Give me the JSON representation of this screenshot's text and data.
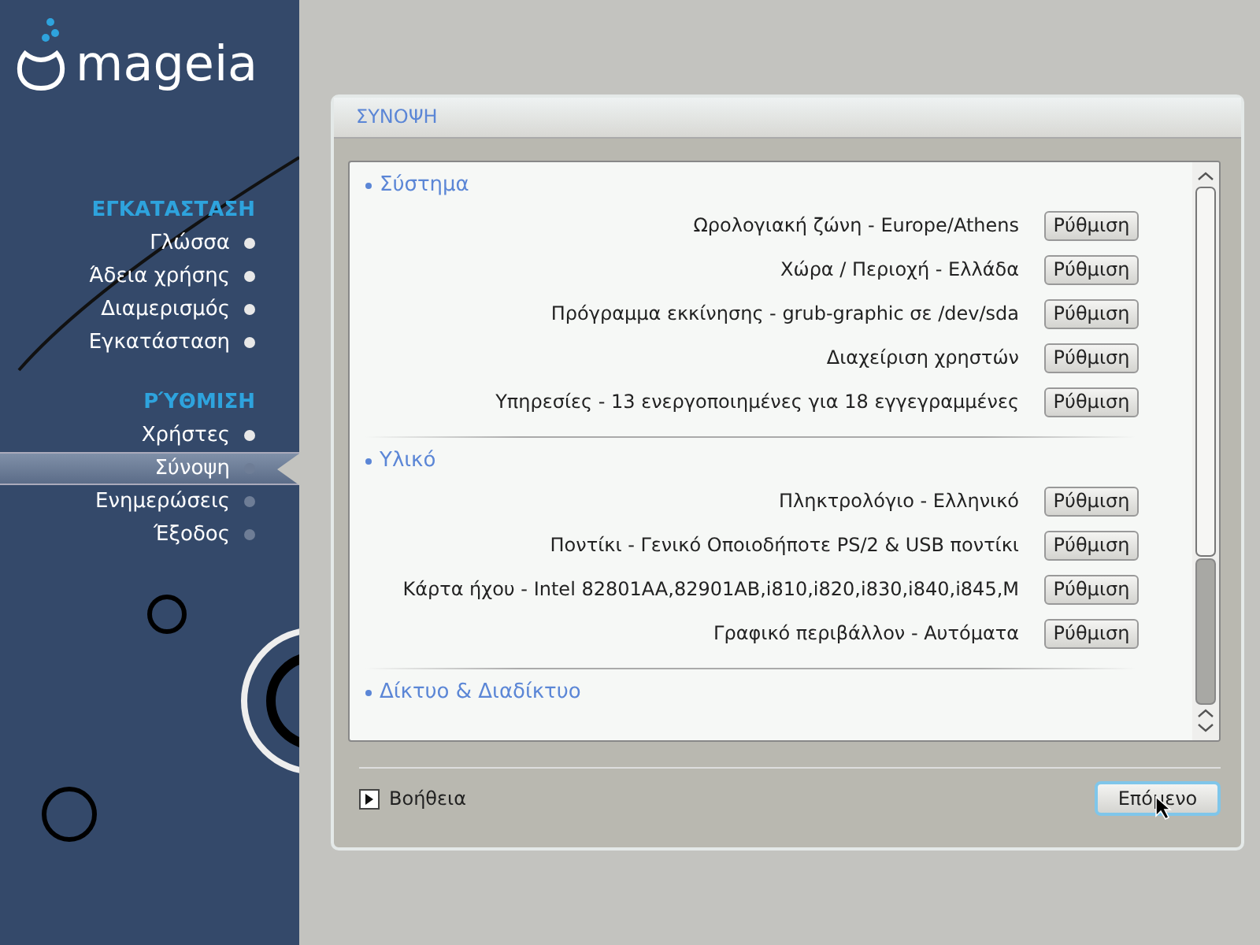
{
  "logo_text": "mageia",
  "sidebar": {
    "groups": [
      {
        "title": "ΕΓΚΑΤΑΣΤΑΣΗ",
        "items": [
          {
            "label": "Γλώσσα",
            "done": true,
            "selected": false
          },
          {
            "label": "Άδεια χρήσης",
            "done": true,
            "selected": false
          },
          {
            "label": "Διαμερισμός",
            "done": true,
            "selected": false
          },
          {
            "label": "Εγκατάσταση",
            "done": true,
            "selected": false
          }
        ]
      },
      {
        "title": "ΡΎΘΜΙΣΗ",
        "items": [
          {
            "label": "Χρήστες",
            "done": true,
            "selected": false
          },
          {
            "label": "Σύνοψη",
            "done": false,
            "selected": true
          },
          {
            "label": "Ενημερώσεις",
            "done": false,
            "selected": false
          },
          {
            "label": "Έξοδος",
            "done": false,
            "selected": false
          }
        ]
      }
    ]
  },
  "panel": {
    "title": "ΣΥΝΟΨΗ",
    "sections": [
      {
        "title": "Σύστημα",
        "rows": [
          {
            "text": "Ωρολογιακή ζώνη - Europe/Athens",
            "button": "Ρύθμιση"
          },
          {
            "text": "Χώρα / Περιοχή - Ελλάδα",
            "button": "Ρύθμιση"
          },
          {
            "text": "Πρόγραμμα εκκίνησης - grub-graphic σε /dev/sda",
            "button": "Ρύθμιση"
          },
          {
            "text": "Διαχείριση χρηστών",
            "button": "Ρύθμιση"
          },
          {
            "text": "Υπηρεσίες - 13 ενεργοποιημένες για 18 εγγεγραμμένες",
            "button": "Ρύθμιση"
          }
        ]
      },
      {
        "title": "Υλικό",
        "rows": [
          {
            "text": "Πληκτρολόγιο - Ελληνικό",
            "button": "Ρύθμιση"
          },
          {
            "text": "Ποντίκι - Γενικό Οποιοδήποτε PS/2 & USB ποντίκι",
            "button": "Ρύθμιση"
          },
          {
            "text": "Κάρτα ήχου - Intel 82801AA,82901AB,i810,i820,i830,i840,i845,M",
            "button": "Ρύθμιση"
          },
          {
            "text": "Γραφικό περιβάλλον - Αυτόματα",
            "button": "Ρύθμιση"
          }
        ]
      },
      {
        "title": "Δίκτυο & Διαδίκτυο"
      }
    ],
    "help": "Βοήθεια",
    "next": "Επόμενο"
  }
}
